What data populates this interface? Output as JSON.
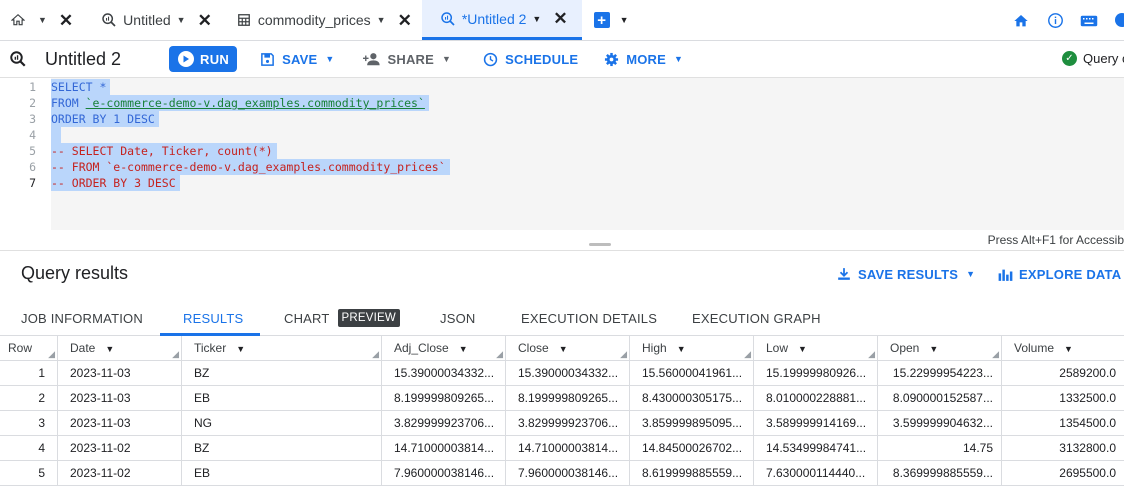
{
  "tabs": [
    {
      "label": "",
      "type": "home",
      "active": false
    },
    {
      "label": "Untitled",
      "type": "query",
      "active": false
    },
    {
      "label": "commodity_prices",
      "type": "table",
      "active": false
    },
    {
      "label": "*Untitled 2",
      "type": "query",
      "active": true
    }
  ],
  "toolbar": {
    "title": "Untitled 2",
    "run_label": "RUN",
    "save_label": "SAVE",
    "share_label": "SHARE",
    "schedule_label": "SCHEDULE",
    "more_label": "MORE",
    "status_label": "Query c"
  },
  "editor": {
    "line_numbers": [
      "1",
      "2",
      "3",
      "4",
      "5",
      "6",
      "7"
    ],
    "lines": [
      "SELECT *",
      "FROM `e-commerce-demo-v.dag_examples.commodity_prices`",
      "ORDER BY 1 DESC",
      "",
      "-- SELECT Date, Ticker, count(*)",
      "-- FROM `e-commerce-demo-v.dag_examples.commodity_prices`",
      "-- ORDER BY 3 DESC"
    ],
    "hint": "Press Alt+F1 for Accessib"
  },
  "results": {
    "title": "Query results",
    "save_results_label": "SAVE RESULTS",
    "explore_data_label": "EXPLORE DATA",
    "tabs": [
      "JOB INFORMATION",
      "RESULTS",
      "CHART",
      "JSON",
      "EXECUTION DETAILS",
      "EXECUTION GRAPH"
    ],
    "preview_badge": "PREVIEW",
    "active_tab": "RESULTS",
    "columns": [
      "Row",
      "Date",
      "Ticker",
      "Adj_Close",
      "Close",
      "High",
      "Low",
      "Open",
      "Volume"
    ],
    "rows": [
      [
        "1",
        "2023-11-03",
        "BZ",
        "15.39000034332...",
        "15.39000034332...",
        "15.56000041961...",
        "15.19999980926...",
        "15.22999954223...",
        "2589200.0"
      ],
      [
        "2",
        "2023-11-03",
        "EB",
        "8.199999809265...",
        "8.199999809265...",
        "8.430000305175...",
        "8.010000228881...",
        "8.090000152587...",
        "1332500.0"
      ],
      [
        "3",
        "2023-11-03",
        "NG",
        "3.829999923706...",
        "3.829999923706...",
        "3.859999895095...",
        "3.589999914169...",
        "3.599999904632...",
        "1354500.0"
      ],
      [
        "4",
        "2023-11-02",
        "BZ",
        "14.71000003814...",
        "14.71000003814...",
        "14.84500026702...",
        "14.53499984741...",
        "14.75",
        "3132800.0"
      ],
      [
        "5",
        "2023-11-02",
        "EB",
        "7.960000038146...",
        "7.960000038146...",
        "8.619999885559...",
        "7.630000114440...",
        "8.369999885559...",
        "2695500.0"
      ]
    ]
  },
  "colors": {
    "accent": "#1a73e8",
    "selection": "#bad6fb",
    "success": "#1e8e3e",
    "comment": "#c5221f",
    "string": "#188038"
  }
}
